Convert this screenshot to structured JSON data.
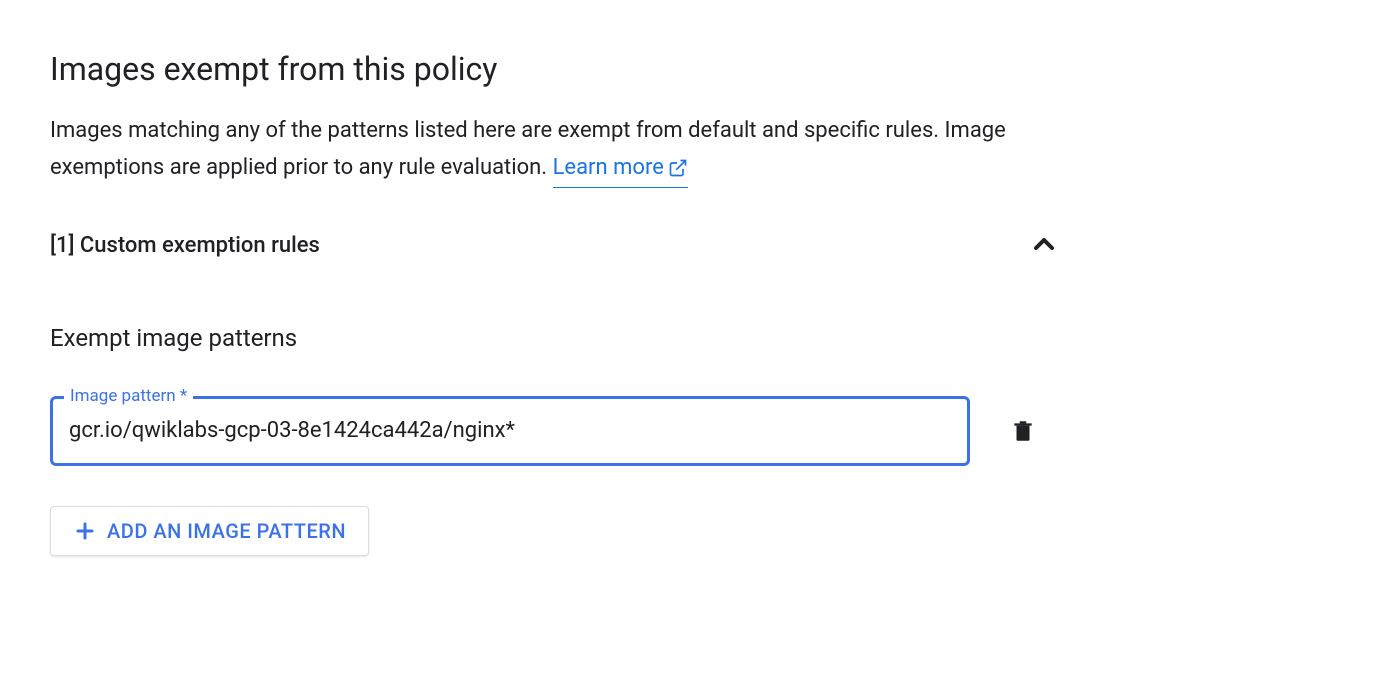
{
  "title": "Images exempt from this policy",
  "description_text": "Images matching any of the patterns listed here are exempt from default and specific rules. Image exemptions are applied prior to any rule evaluation. ",
  "learn_more": "Learn more",
  "collapse": {
    "title": "[1] Custom exemption rules"
  },
  "subsection_title": "Exempt image patterns",
  "input": {
    "label": "Image pattern *",
    "value": "gcr.io/qwiklabs-gcp-03-8e1424ca442a/nginx*"
  },
  "add_button": "ADD AN IMAGE PATTERN"
}
